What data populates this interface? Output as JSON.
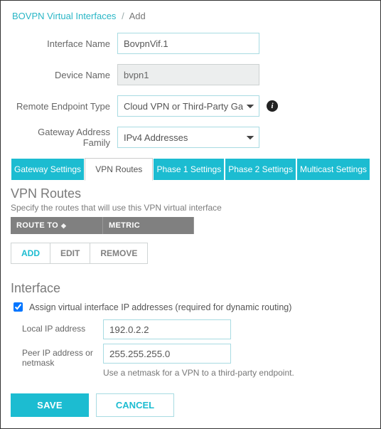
{
  "breadcrumb": {
    "parent": "BOVPN Virtual Interfaces",
    "current": "Add"
  },
  "form": {
    "interface_name_label": "Interface Name",
    "interface_name_value": "BovpnVif.1",
    "device_name_label": "Device Name",
    "device_name_value": "bvpn1",
    "remote_endpoint_label": "Remote Endpoint Type",
    "remote_endpoint_value": "Cloud VPN or Third-Party Gateway",
    "gateway_family_label": "Gateway Address Family",
    "gateway_family_value": "IPv4 Addresses"
  },
  "tabs": {
    "gateway": "Gateway Settings",
    "vpn_routes": "VPN Routes",
    "phase1": "Phase 1 Settings",
    "phase2": "Phase 2 Settings",
    "multicast": "Multicast Settings"
  },
  "routes": {
    "title": "VPN Routes",
    "subtitle": "Specify the routes that will use this VPN virtual interface",
    "col_route_to": "ROUTE TO",
    "col_metric": "METRIC",
    "btn_add": "ADD",
    "btn_edit": "EDIT",
    "btn_remove": "REMOVE"
  },
  "iface": {
    "title": "Interface",
    "checkbox_label": "Assign virtual interface IP addresses (required for dynamic routing)",
    "local_label": "Local IP address",
    "local_value": "192.0.2.2",
    "peer_label": "Peer IP address or netmask",
    "peer_value": "255.255.255.0",
    "hint": "Use a netmask for a VPN to a third-party endpoint."
  },
  "footer": {
    "save": "SAVE",
    "cancel": "CANCEL"
  }
}
